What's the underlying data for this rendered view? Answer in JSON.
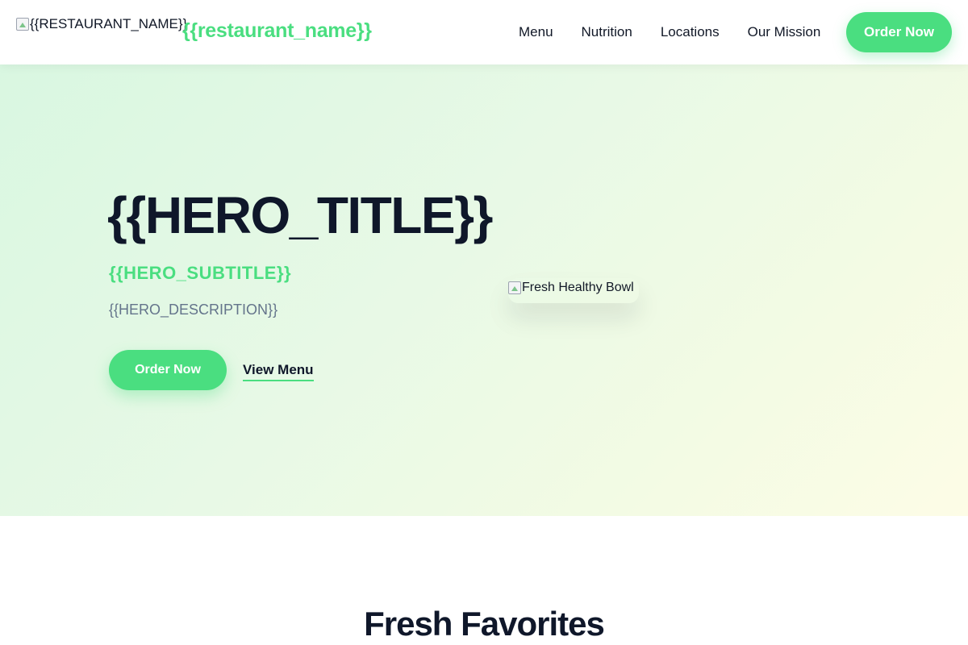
{
  "header": {
    "logo_alt": "{{RESTAURANT_NAME}}",
    "brand_name": "{{restaurant_name}}",
    "nav": [
      {
        "label": "Menu"
      },
      {
        "label": "Nutrition"
      },
      {
        "label": "Locations"
      },
      {
        "label": "Our Mission"
      }
    ],
    "cta_label": "Order Now"
  },
  "hero": {
    "title": "{{HERO_TITLE}}",
    "subtitle": "{{HERO_SUBTITLE}}",
    "description": "{{HERO_DESCRIPTION}}",
    "primary_button": "Order Now",
    "secondary_link": "View Menu",
    "image_alt": "Fresh Healthy Bowl"
  },
  "favorites": {
    "title": "Fresh Favorites"
  },
  "colors": {
    "accent": "#4ade80",
    "text_dark": "#0f172a",
    "text_muted": "#64748b"
  }
}
